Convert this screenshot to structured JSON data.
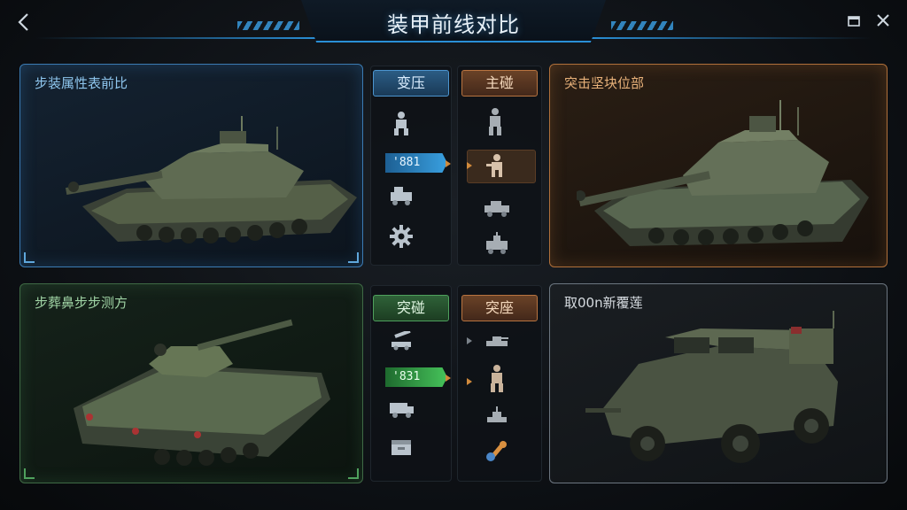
{
  "header": {
    "title": "装甲前线对比",
    "back_icon": "chevron-left-icon",
    "window_icon": "window-icon",
    "close_icon": "close-icon",
    "accent": "#2a8fd6"
  },
  "panels": {
    "top_left": {
      "label": "步装属性表前比"
    },
    "top_right": {
      "label": "突击坚块位部"
    },
    "bottom_left": {
      "label": "步葬鼻步步测方"
    },
    "bottom_right": {
      "label": "取00n新覆莲"
    }
  },
  "columns": {
    "top_left_col": {
      "tab": "变压",
      "badge": "'881",
      "icons": [
        "soldier-icon",
        "vehicle-icon",
        "gear-icon"
      ]
    },
    "top_right_col": {
      "tab": "主碰",
      "icons": [
        "soldier-icon",
        "soldier-selected-icon",
        "vehicle-icon",
        "vehicle-small-icon"
      ]
    },
    "bottom_left_col": {
      "tab": "突碰",
      "badge": "'831",
      "icons": [
        "artillery-icon",
        "truck-icon",
        "crate-icon"
      ]
    },
    "bottom_right_col": {
      "tab": "突座",
      "icons": [
        "tank-small-icon",
        "soldier-icon",
        "turret-icon",
        "wrench-icon"
      ]
    }
  },
  "colors": {
    "blue": "#3b7bb3",
    "orange": "#b0703a",
    "green": "#3f6a45",
    "gray": "#6c7680"
  }
}
